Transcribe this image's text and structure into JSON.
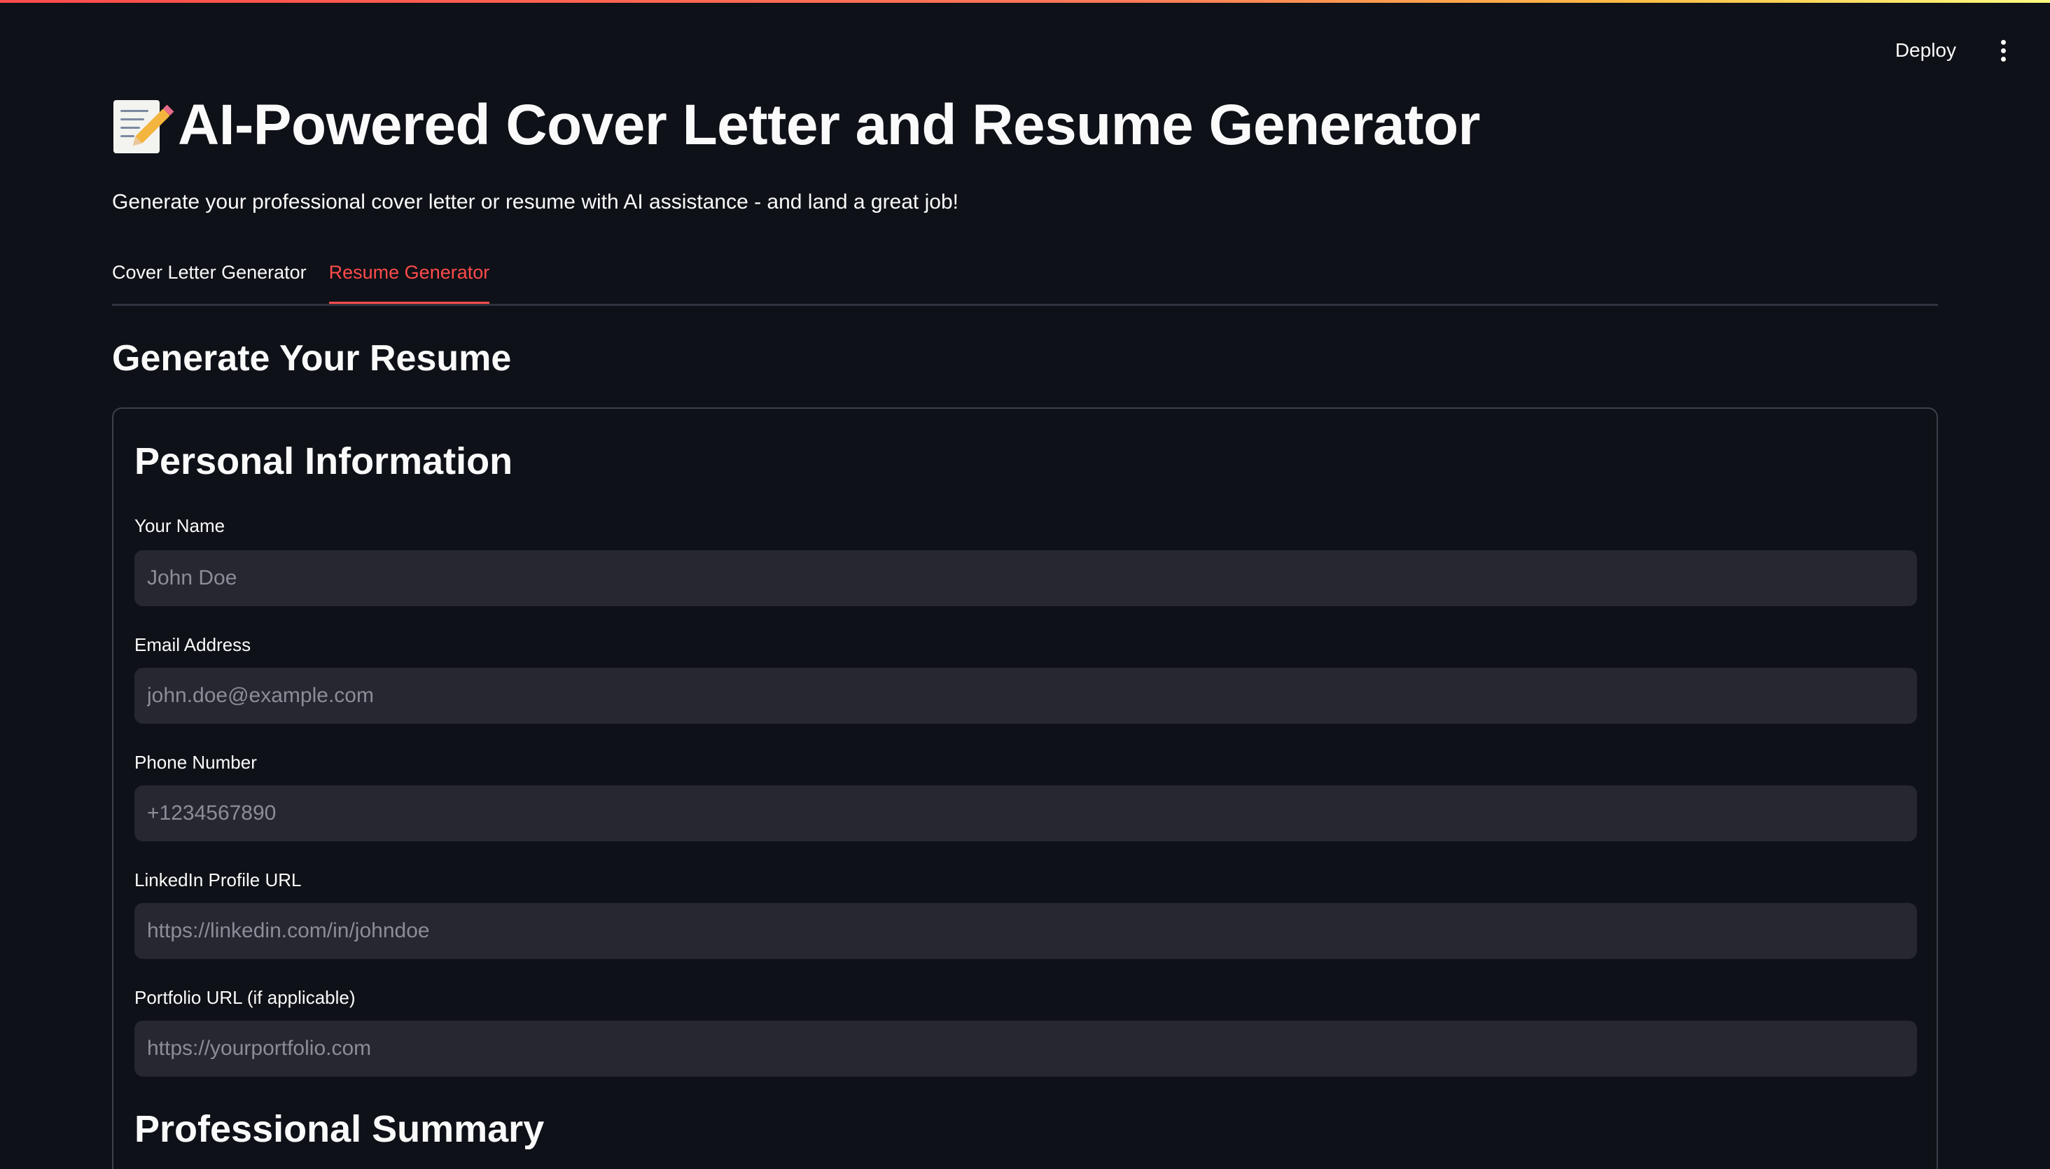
{
  "header": {
    "deploy_label": "Deploy",
    "menu_icon": "vertical-ellipsis-icon"
  },
  "page": {
    "title_icon": "memo-icon",
    "title": "AI-Powered Cover Letter and Resume Generator",
    "subtitle": "Generate your professional cover letter or resume with AI assistance - and land a great job!"
  },
  "tabs": [
    {
      "label": "Cover Letter Generator",
      "active": false
    },
    {
      "label": "Resume Generator",
      "active": true
    }
  ],
  "main": {
    "section_heading": "Generate Your Resume"
  },
  "form": {
    "personal_heading": "Personal Information",
    "fields": [
      {
        "label": "Your Name",
        "value": "",
        "placeholder": "John Doe"
      },
      {
        "label": "Email Address",
        "value": "",
        "placeholder": "john.doe@example.com"
      },
      {
        "label": "Phone Number",
        "value": "",
        "placeholder": "+1234567890"
      },
      {
        "label": "LinkedIn Profile URL",
        "value": "",
        "placeholder": "https://linkedin.com/in/johndoe"
      },
      {
        "label": "Portfolio URL (if applicable)",
        "value": "",
        "placeholder": "https://yourportfolio.com"
      }
    ],
    "summary_heading": "Professional Summary"
  },
  "colors": {
    "background": "#0e1117",
    "accent": "#ff4b4b",
    "input_background": "#262730",
    "placeholder": "#8b8d97"
  }
}
